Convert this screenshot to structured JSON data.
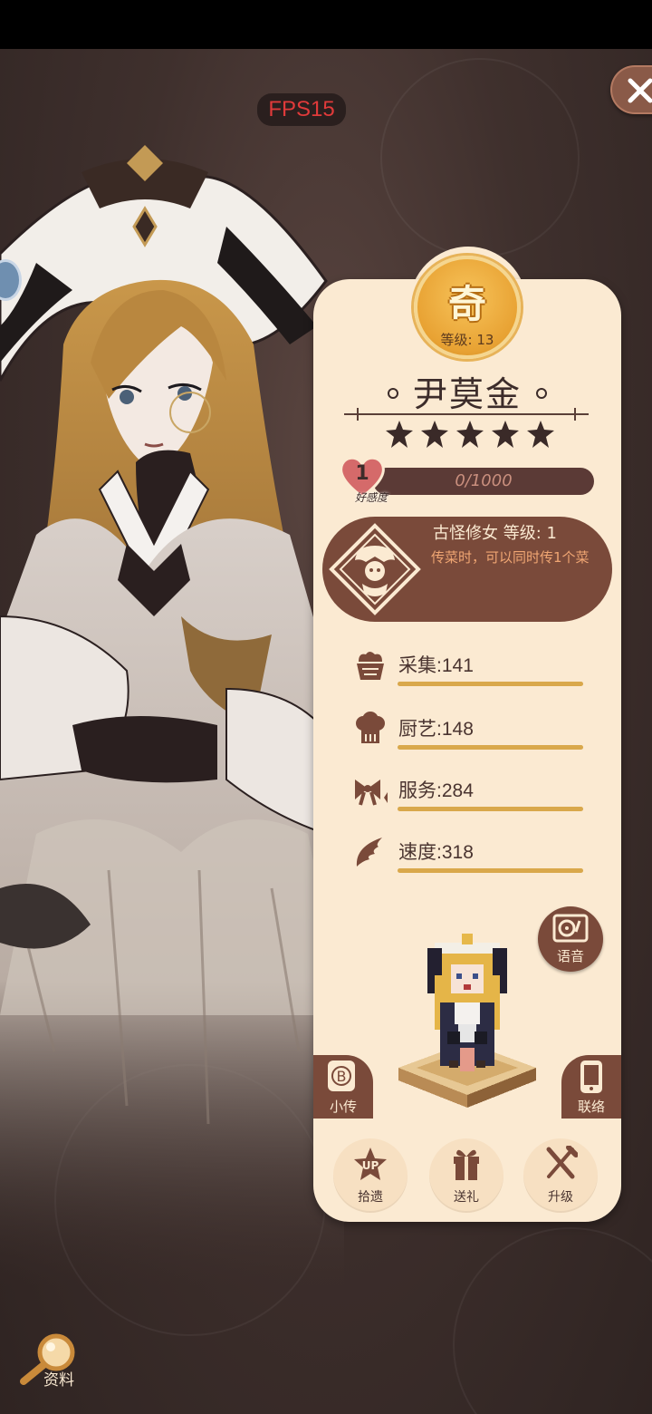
{
  "fps": "FPS15",
  "rarity": {
    "char": "奇",
    "level_text": "等级: 13"
  },
  "character": {
    "name": "尹莫金",
    "stars": 5
  },
  "affection": {
    "level": "1",
    "label": "好感度",
    "progress_text": "0/1000",
    "progress_fraction": 0.0
  },
  "skill": {
    "title": "古怪修女  等级: 1",
    "description": "传菜时，可以同时传1个菜"
  },
  "stats": [
    {
      "label": "采集:141",
      "fill": 1.0
    },
    {
      "label": "厨艺:148",
      "fill": 1.0
    },
    {
      "label": "服务:284",
      "fill": 1.0
    },
    {
      "label": "速度:318",
      "fill": 1.0
    }
  ],
  "buttons": {
    "voice": "语音",
    "bio": "小传",
    "contact": "联络",
    "bio_badge": "B",
    "pickup": {
      "badge": "UP",
      "label": "拾遗"
    },
    "gift": "送礼",
    "upgrade": "升级",
    "profile": "资料"
  },
  "colors": {
    "panel": "#fbead2",
    "accent_brown": "#7a4a3a",
    "gold": "#d9a84b",
    "fps_red": "#e03a3a"
  }
}
